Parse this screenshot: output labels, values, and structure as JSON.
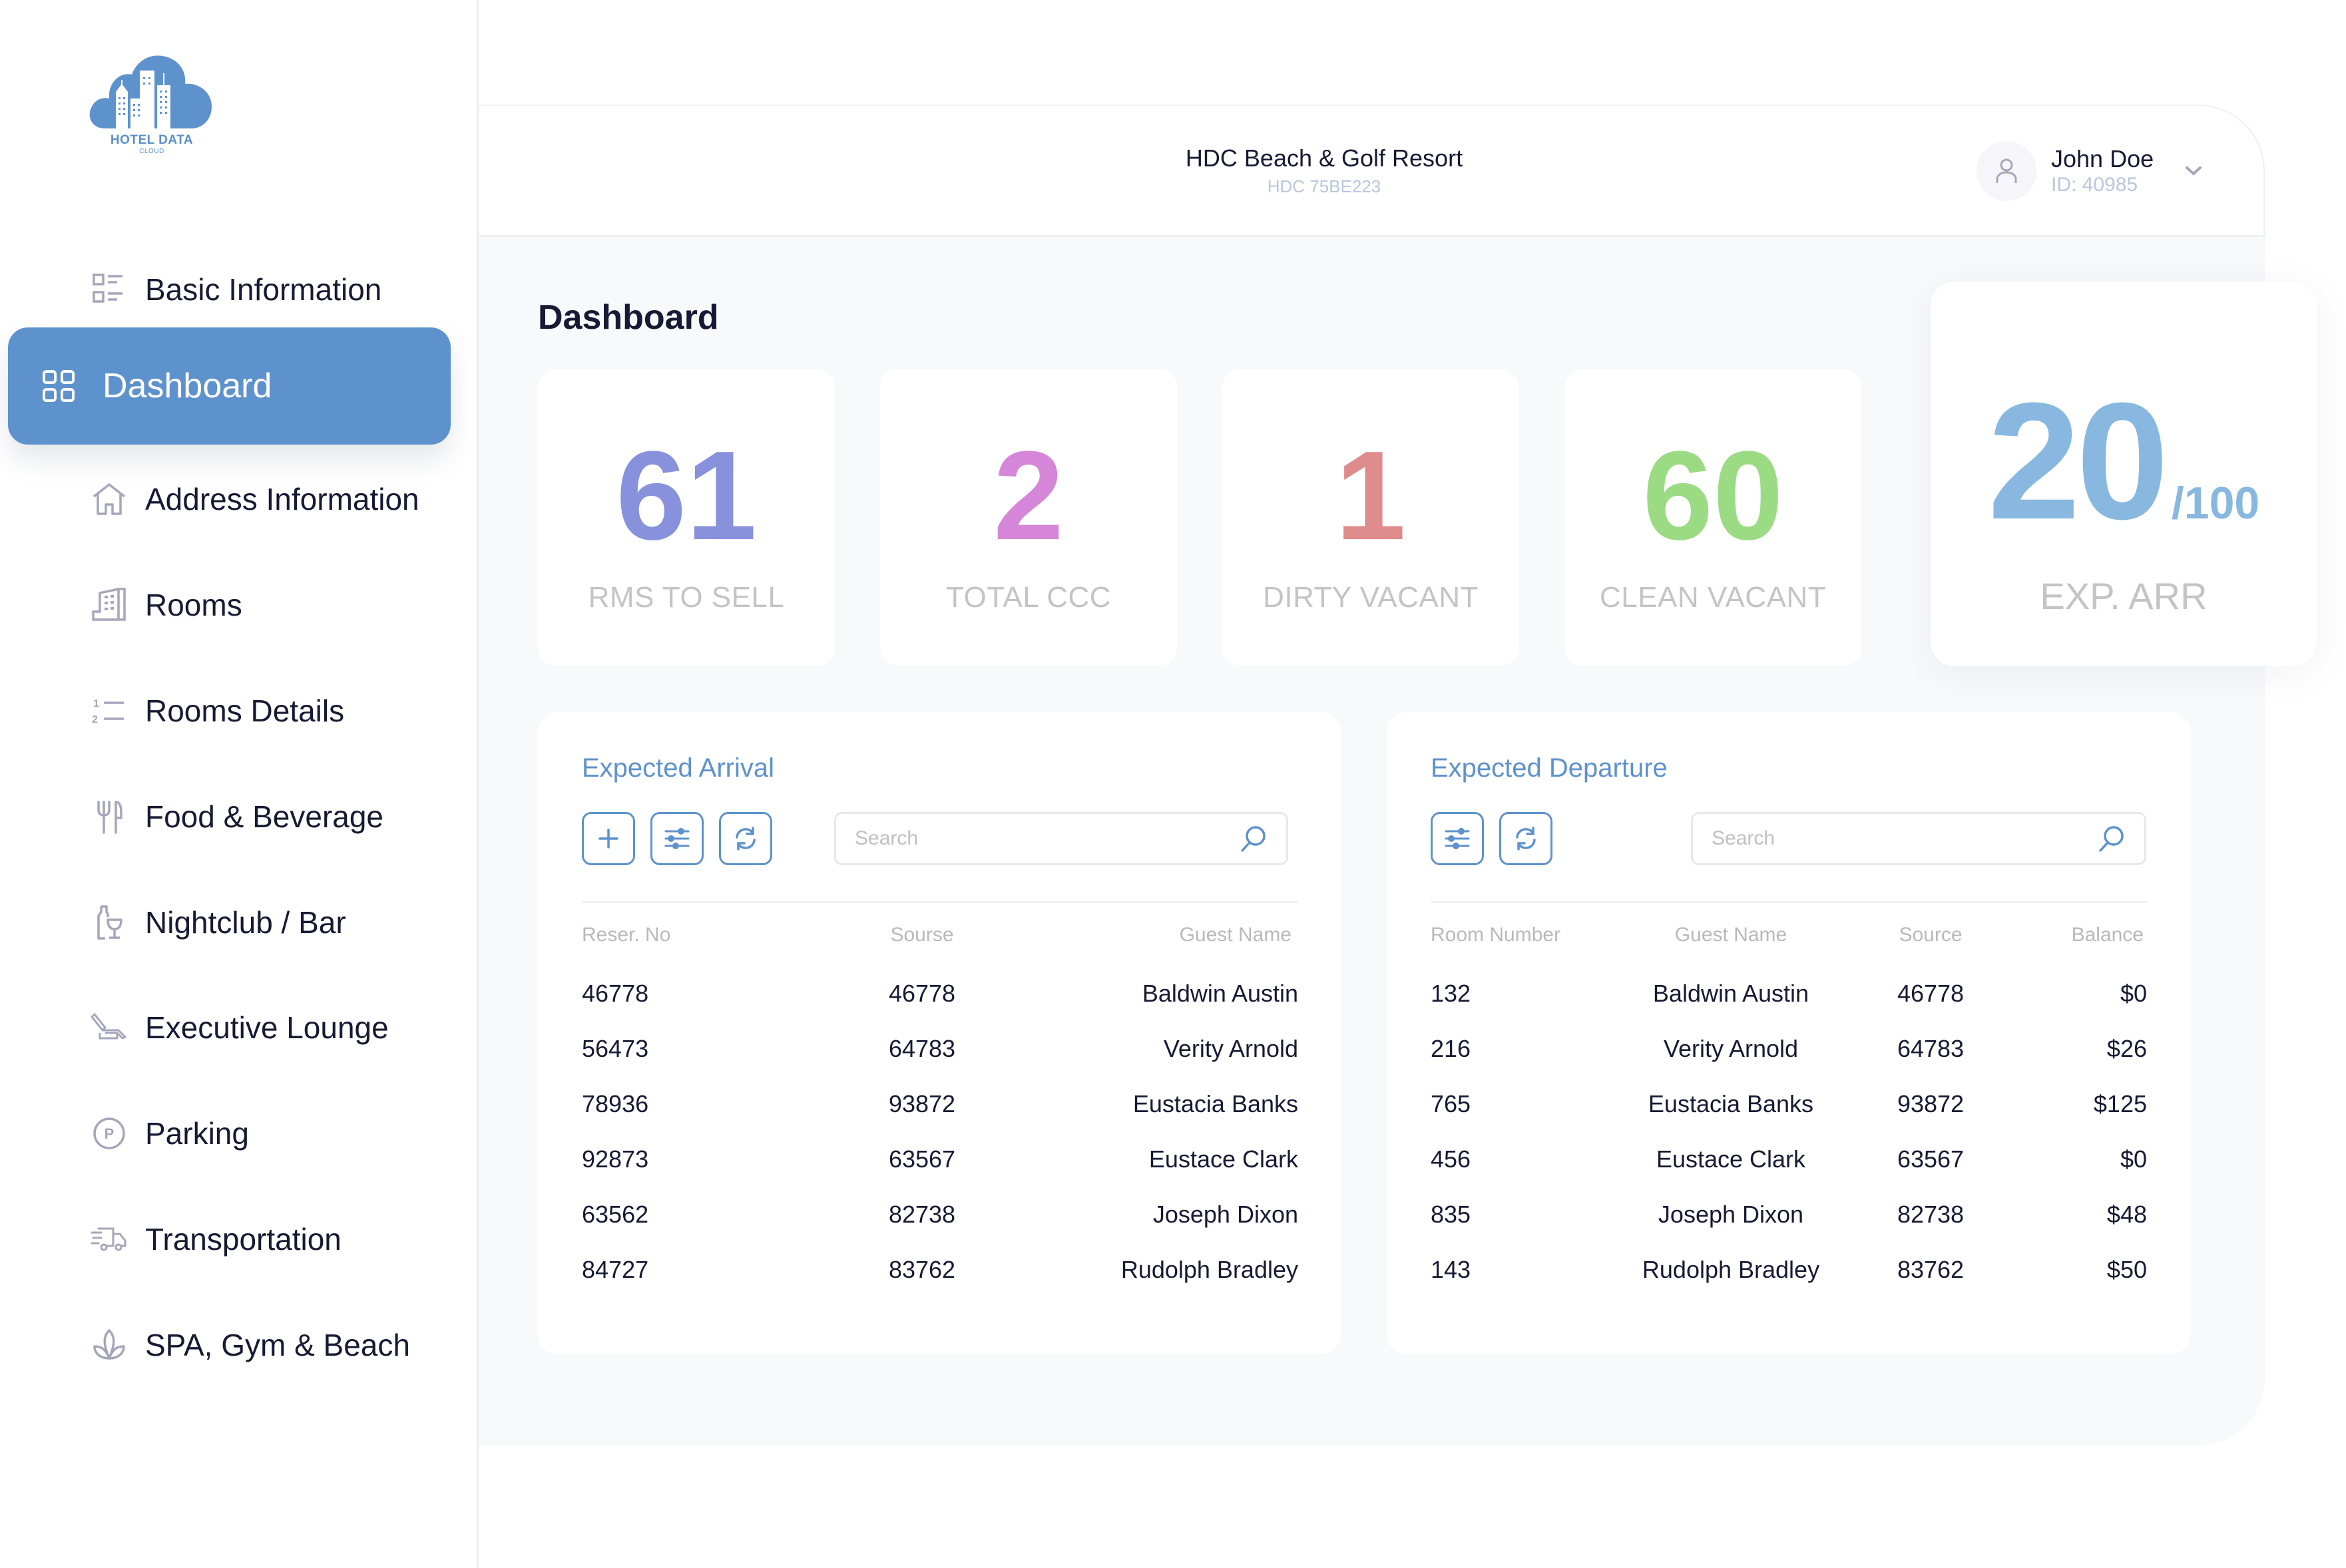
{
  "brand": {
    "name": "HOTEL DATA",
    "subtitle": "CLOUD",
    "color": "#5e92cc"
  },
  "sidebar": {
    "items": [
      {
        "label": "Basic Information",
        "icon": "list-icon",
        "active": false
      },
      {
        "label": "Dashboard",
        "icon": "grid-icon",
        "active": true
      },
      {
        "label": "Address Information",
        "icon": "home-icon",
        "active": false
      },
      {
        "label": "Rooms",
        "icon": "building-icon",
        "active": false
      },
      {
        "label": "Rooms Details",
        "icon": "numbered-list-icon",
        "active": false
      },
      {
        "label": "Food & Beverage",
        "icon": "fork-knife-icon",
        "active": false
      },
      {
        "label": "Nightclub / Bar",
        "icon": "bottle-glass-icon",
        "active": false
      },
      {
        "label": "Executive Lounge",
        "icon": "lounge-chair-icon",
        "active": false
      },
      {
        "label": "Parking",
        "icon": "parking-icon",
        "active": false
      },
      {
        "label": "Transportation",
        "icon": "truck-icon",
        "active": false
      },
      {
        "label": "SPA, Gym & Beach",
        "icon": "lotus-icon",
        "active": false
      }
    ]
  },
  "header": {
    "hotel_name": "HDC Beach & Golf Resort",
    "hotel_code": "HDC 75BE223",
    "user": {
      "name": "John Doe",
      "id": "ID: 40985"
    }
  },
  "page": {
    "title": "Dashboard"
  },
  "stats": [
    {
      "value": "61",
      "label": "RMS TO SELL",
      "color": "#8891dc"
    },
    {
      "value": "2",
      "label": "TOTAL CCC",
      "color": "#d686d8"
    },
    {
      "value": "1",
      "label": "DIRTY VACANT",
      "color": "#df8a8b"
    },
    {
      "value": "60",
      "label": "CLEAN VACANT",
      "color": "#9bdb84"
    }
  ],
  "exp_arr": {
    "value": "20",
    "total": "/100",
    "label": "EXP. ARR",
    "color": "#88b8df"
  },
  "arrival": {
    "title": "Expected Arrival",
    "search_placeholder": "Search",
    "columns": [
      "Reser. No",
      "Sourse",
      "Guest Name"
    ],
    "rows": [
      [
        "46778",
        "46778",
        "Baldwin Austin"
      ],
      [
        "56473",
        "64783",
        "Verity Arnold"
      ],
      [
        "78936",
        "93872",
        "Eustacia Banks"
      ],
      [
        "92873",
        "63567",
        "Eustace Clark"
      ],
      [
        "63562",
        "82738",
        "Joseph Dixon"
      ],
      [
        "84727",
        "83762",
        "Rudolph Bradley"
      ]
    ]
  },
  "departure": {
    "title": "Expected Departure",
    "search_placeholder": "Search",
    "columns": [
      "Room Number",
      "Guest Name",
      "Source",
      "Balance"
    ],
    "rows": [
      [
        "132",
        "Baldwin Austin",
        "46778",
        "$0"
      ],
      [
        "216",
        "Verity Arnold",
        "64783",
        "$26"
      ],
      [
        "765",
        "Eustacia Banks",
        "93872",
        "$125"
      ],
      [
        "456",
        "Eustace Clark",
        "63567",
        "$0"
      ],
      [
        "835",
        "Joseph Dixon",
        "82738",
        "$48"
      ],
      [
        "143",
        "Rudolph Bradley",
        "83762",
        "$50"
      ]
    ]
  }
}
